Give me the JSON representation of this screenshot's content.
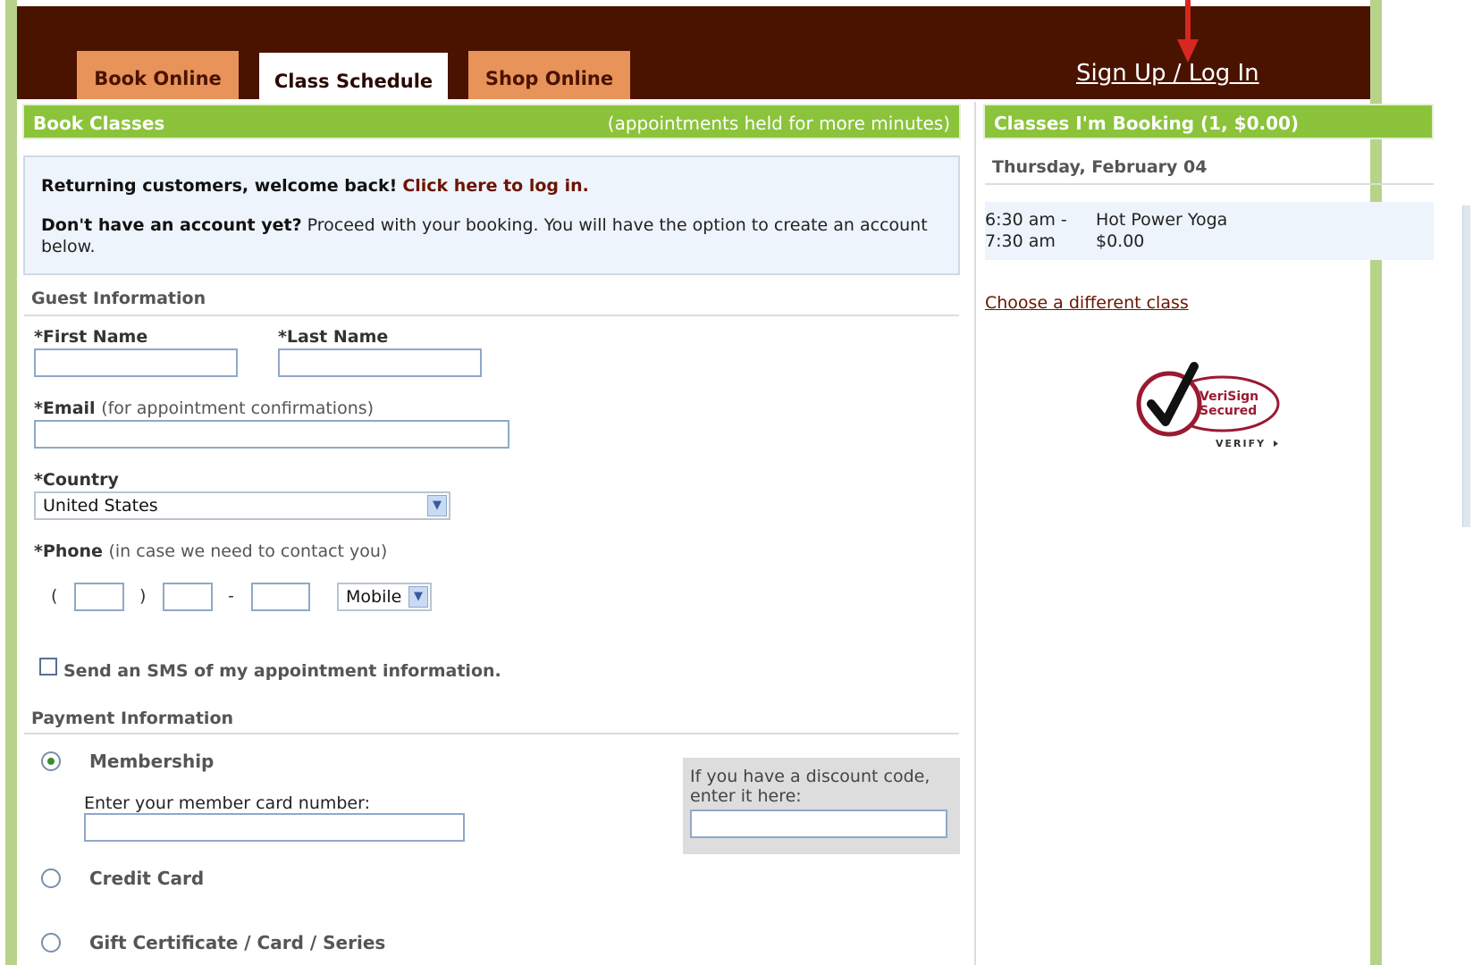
{
  "header": {
    "tabs": [
      {
        "label": "Book Online",
        "active": false
      },
      {
        "label": "Class Schedule",
        "active": true
      },
      {
        "label": "Shop Online",
        "active": false
      }
    ],
    "signup_label": "Sign Up / Log In"
  },
  "booking": {
    "title": "Book Classes",
    "hold_note": "(appointments held for more minutes)"
  },
  "welcome": {
    "returning_text": "Returning customers, welcome back!",
    "login_link": "Click here to log in.",
    "no_account_bold": "Don't have an account yet?",
    "no_account_text": "Proceed with your booking. You will have the option to create an account below."
  },
  "guest": {
    "heading": "Guest Information",
    "first_name_label": "*First Name",
    "last_name_label": "*Last Name",
    "email_label": "*Email",
    "email_note": "(for appointment confirmations)",
    "country_label": "*Country",
    "country_value": "United States",
    "phone_label": "*Phone",
    "phone_note": "(in case we need to contact you)",
    "phone_open": "(",
    "phone_close": ")",
    "phone_dash": "-",
    "phone_type": "Mobile",
    "sms_label": "Send an SMS of my appointment information."
  },
  "payment": {
    "heading": "Payment Information",
    "options": [
      {
        "label": "Membership",
        "checked": true
      },
      {
        "label": "Credit Card",
        "checked": false
      },
      {
        "label": "Gift Certificate / Card / Series",
        "checked": false
      }
    ],
    "member_card_label": "Enter your member card number:",
    "discount_label": "If you have a discount code, enter it here:"
  },
  "cart": {
    "title": "Classes I'm Booking (1, $0.00)",
    "date": "Thursday, February 04",
    "time_start": "6:30 am -",
    "time_end": "7:30 am",
    "class_name": "Hot Power Yoga",
    "price": "$0.00",
    "choose_link": "Choose a different class",
    "badge_line1": "VeriSign",
    "badge_line2": "Secured",
    "badge_verify": "VERIFY"
  },
  "colors": {
    "header_bg": "#4a1300",
    "tab_bg": "#e8935a",
    "bar_green": "#8bc33a",
    "link_dark_red": "#6b1400"
  }
}
